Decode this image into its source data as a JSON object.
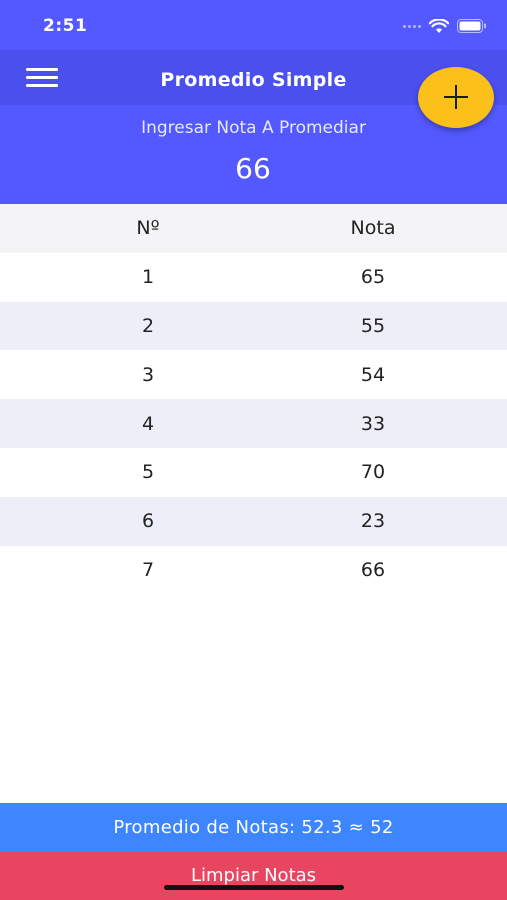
{
  "status_bar": {
    "time": "2:51",
    "icons": [
      "signal-dots-icon",
      "wifi-icon",
      "battery-icon"
    ]
  },
  "app_bar": {
    "menu_icon": "hamburger-menu-icon",
    "title": "Promedio Simple"
  },
  "input": {
    "label": "Ingresar Nota A Promediar",
    "value": "66"
  },
  "fab": {
    "icon": "plus-icon",
    "color": "#fcc01b"
  },
  "table": {
    "headers": [
      "Nº",
      "Nota"
    ],
    "rows": [
      {
        "n": "1",
        "nota": "65"
      },
      {
        "n": "2",
        "nota": "55"
      },
      {
        "n": "3",
        "nota": "54"
      },
      {
        "n": "4",
        "nota": "33"
      },
      {
        "n": "5",
        "nota": "70"
      },
      {
        "n": "6",
        "nota": "23"
      },
      {
        "n": "7",
        "nota": "66"
      }
    ]
  },
  "footer": {
    "average_text": "Promedio de Notas: 52.3 ≈ 52",
    "clear_label": "Limpiar Notas"
  },
  "colors": {
    "primary": "#5359ff",
    "app_bar": "#4a4fee",
    "accent": "#fcc01b",
    "average_bar": "#3d86ff",
    "danger": "#e84561"
  }
}
